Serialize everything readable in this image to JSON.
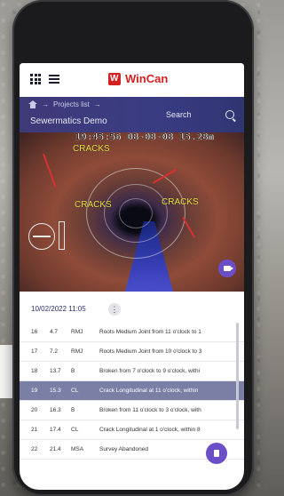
{
  "header": {
    "brand": "WinCan"
  },
  "nav": {
    "crumb": "Projects list",
    "project": "Sewermatics Demo",
    "search_label": "Search"
  },
  "video": {
    "osd": "19:45:56 08-08-08   15.28m",
    "labels": [
      "CRACKS",
      "CRACKS",
      "CRACKS"
    ]
  },
  "section": {
    "date": "10/02/2022 11:05"
  },
  "rows": [
    {
      "no": "16",
      "dist": "4.7",
      "code": "RMJ",
      "desc": "Roots Medium Joint from 11 o'clock to 1",
      "selected": false
    },
    {
      "no": "17",
      "dist": "7.2",
      "code": "RMJ",
      "desc": "Roots Medium Joint from 10 o'clock to 3",
      "selected": false
    },
    {
      "no": "18",
      "dist": "13.7",
      "code": "B",
      "desc": "Broken from 7 o'clock to 9 o'clock, withi",
      "selected": false
    },
    {
      "no": "19",
      "dist": "15.3",
      "code": "CL",
      "desc": "Crack Longitudinal at 11 o'clock, within",
      "selected": true
    },
    {
      "no": "20",
      "dist": "16.3",
      "code": "B",
      "desc": "Broken from 11 o'clock to 3 o'clock, with",
      "selected": false
    },
    {
      "no": "21",
      "dist": "17.4",
      "code": "CL",
      "desc": "Crack Longitudinal at 1 o'clock, within 8",
      "selected": false
    },
    {
      "no": "22",
      "dist": "21.4",
      "code": "MSA",
      "desc": "Survey Abandoned",
      "selected": false
    }
  ]
}
